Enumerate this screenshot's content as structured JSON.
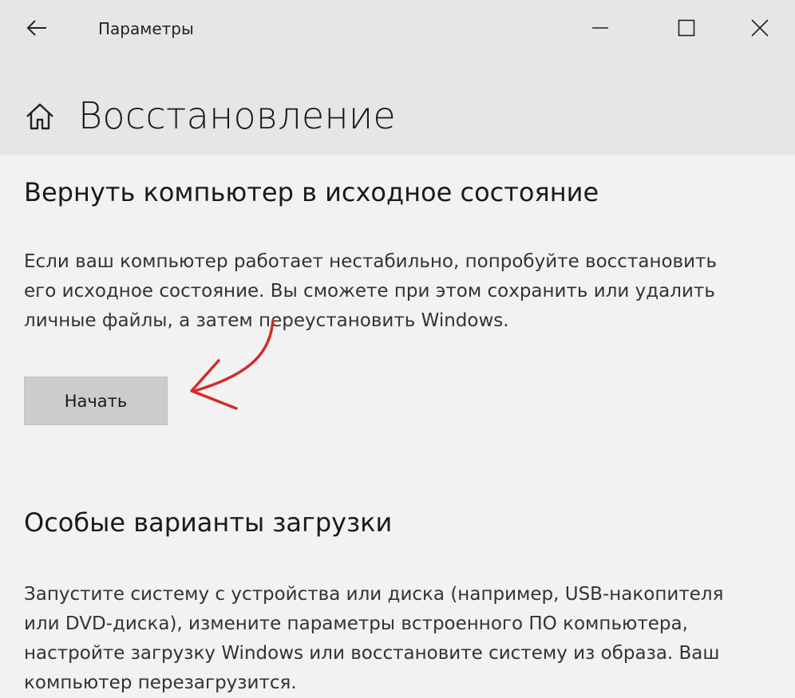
{
  "window": {
    "title": "Параметры",
    "back_icon": "arrow-left-icon",
    "minimize_icon": "minimize-icon",
    "maximize_icon": "maximize-icon",
    "close_icon": "close-icon"
  },
  "header": {
    "icon": "home-icon",
    "title": "Восстановление"
  },
  "reset_section": {
    "title": "Вернуть компьютер в исходное состояние",
    "description": "Если ваш компьютер работает нестабильно, попробуйте восстановить его исходное состояние. Вы сможете при этом сохранить или удалить личные файлы, а затем переустановить Windows.",
    "button_label": "Начать"
  },
  "advanced_section": {
    "title": "Особые варианты загрузки",
    "description": "Запустите систему с устройства или диска (например, USB-накопителя или DVD-диска), измените параметры встроенного ПО компьютера, настройте загрузку Windows или восстановите систему из образа. Ваш компьютер перезагрузится."
  },
  "annotation": {
    "icon": "red-arrow-icon",
    "color": "#d42a2a"
  },
  "colors": {
    "titlebar_bg": "#e6e6e6",
    "content_bg": "#f2f2f2",
    "button_bg": "#cccccc"
  }
}
